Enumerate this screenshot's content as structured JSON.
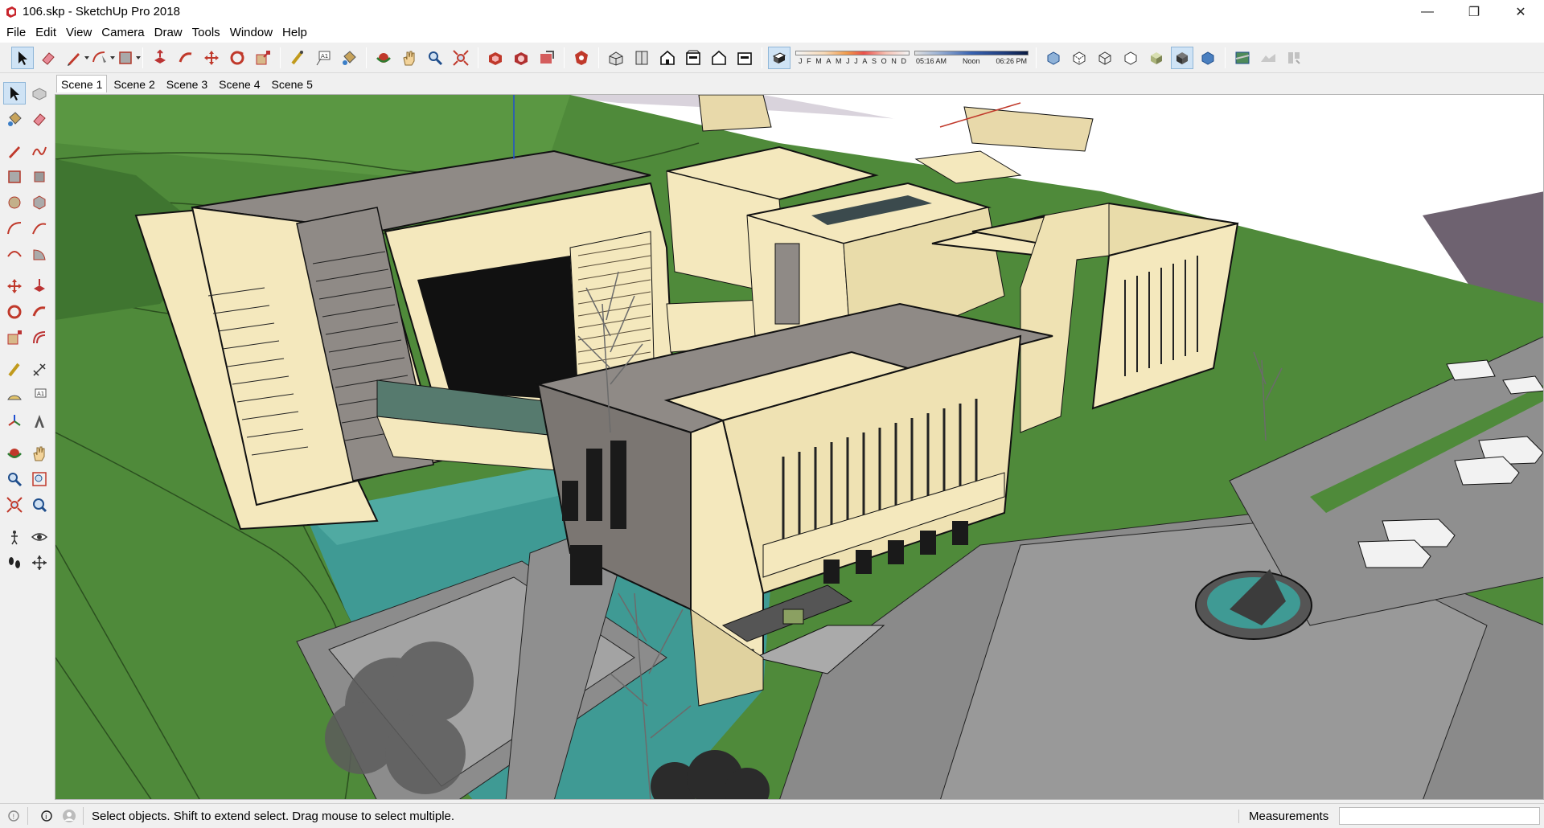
{
  "window": {
    "title": "106.skp - SketchUp Pro 2018"
  },
  "menubar": {
    "items": [
      "File",
      "Edit",
      "View",
      "Camera",
      "Draw",
      "Tools",
      "Window",
      "Help"
    ]
  },
  "shadow": {
    "months": [
      "J",
      "F",
      "M",
      "A",
      "M",
      "J",
      "J",
      "A",
      "S",
      "O",
      "N",
      "D"
    ],
    "time_start": "05:16 AM",
    "time_noon": "Noon",
    "time_end": "06:26 PM"
  },
  "scenes": [
    "Scene 1",
    "Scene 2",
    "Scene 3",
    "Scene 4",
    "Scene 5"
  ],
  "active_scene": "Scene 1",
  "status": {
    "text": "Select objects. Shift to extend select. Drag mouse to select multiple.",
    "measurements_label": "Measurements",
    "measurements_value": ""
  },
  "colors": {
    "grass": "#4f8a3a",
    "water": "#3f9a94",
    "building_light": "#f4e8bd",
    "building_roof": "#8f8a86",
    "paving": "#8c8c8c"
  }
}
